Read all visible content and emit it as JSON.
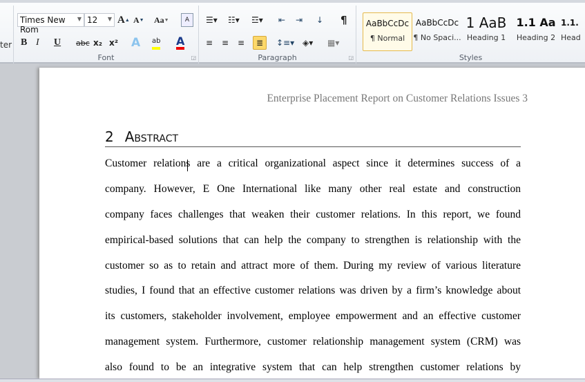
{
  "ribbon": {
    "prev_group_fragment": "ter",
    "font": {
      "label": "Font",
      "font_name": "Times New Rom",
      "font_size": "12",
      "grow": "A",
      "shrink": "A",
      "case": "Aa",
      "bold": "B",
      "italic": "I",
      "underline": "U",
      "strike": "abc",
      "sub": "x₂",
      "sup": "x²",
      "effects": "A",
      "highlight": "ab",
      "color": "A",
      "highlight_color": "#ffff00",
      "font_color": "#e00000"
    },
    "paragraph": {
      "label": "Paragraph",
      "pilcrow": "¶",
      "active_alignment": "justify"
    },
    "styles": {
      "label": "Styles",
      "items": [
        {
          "preview": "AaBbCcDc",
          "name": "¶ Normal",
          "selected": true
        },
        {
          "preview": "AaBbCcDc",
          "name": "¶ No Spaci..."
        },
        {
          "preview": "1  AaB",
          "name": "Heading 1"
        },
        {
          "preview": "1.1  Aa",
          "name": "Heading 2"
        },
        {
          "preview": "1.1.",
          "name": "Head"
        }
      ]
    }
  },
  "document": {
    "running_header": "Enterprise Placement Report on Customer Relations Issues 3",
    "heading_number": "2",
    "heading_text": "Abstract",
    "lines": [
      "Customer relations are a critical organizational aspect since it determines success of a",
      "company. However, E One International like many other real estate and construction",
      "company faces challenges that weaken their customer relations. In this report, we found",
      "empirical-based solutions that can help the company to strengthen is relationship with the",
      "customer so as to retain and attract more of them. During my review of various literature",
      "studies, I found that an effective customer relations was driven by a firm’s knowledge about",
      "its customers, stakeholder involvement, employee empowerment and an effective customer",
      "management system. Furthermore, customer relationship management system (CRM) was",
      "also found to be an integrative system that can help strengthen customer relations by"
    ]
  }
}
